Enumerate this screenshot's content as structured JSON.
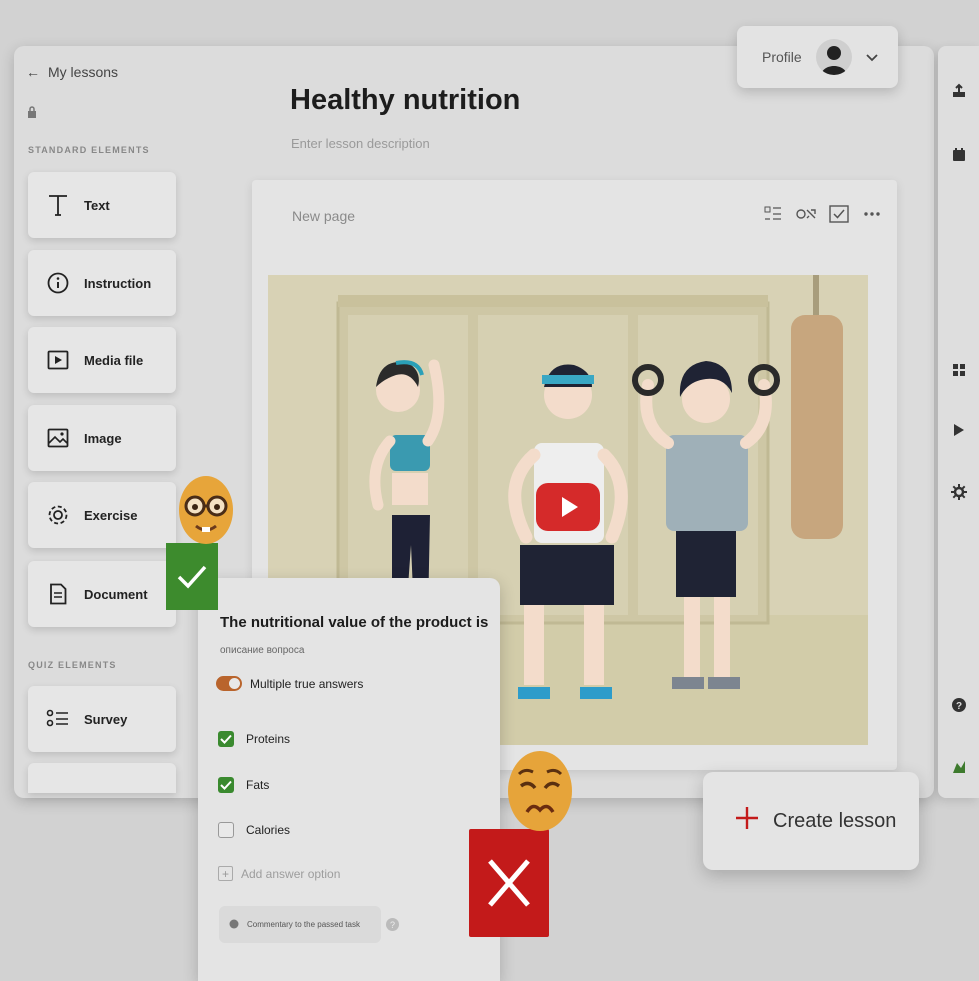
{
  "editor": {
    "back_label": "My lessons",
    "standard_section": "STANDARD ELEMENTS",
    "quiz_section": "QUIZ ELEMENTS",
    "elements": [
      {
        "label": "Text",
        "icon": "text-icon"
      },
      {
        "label": "Instruction",
        "icon": "info-icon"
      },
      {
        "label": "Media file",
        "icon": "media-icon"
      },
      {
        "label": "Image",
        "icon": "image-icon"
      },
      {
        "label": "Exercise",
        "icon": "gear-icon"
      },
      {
        "label": "Document",
        "icon": "document-icon"
      }
    ],
    "quiz_elements": [
      {
        "label": "Survey",
        "icon": "survey-icon"
      },
      {
        "label": "",
        "icon": ""
      }
    ]
  },
  "lesson": {
    "title": "Healthy nutrition",
    "description_placeholder": "Enter lesson description"
  },
  "profile": {
    "label": "Profile"
  },
  "page": {
    "name": "New page"
  },
  "quiz": {
    "question": "The nutritional value of the product is",
    "subtitle": "описание вопроса",
    "toggle_label": "Multiple true answers",
    "toggle_on": true,
    "answers": [
      {
        "label": "Proteins",
        "checked": true
      },
      {
        "label": "Fats",
        "checked": true
      },
      {
        "label": "Calories",
        "checked": false
      }
    ],
    "add_option": "Add answer option",
    "comment_button": "Commentary to the passed task"
  },
  "create_lesson": {
    "label": "Create lesson"
  },
  "colors": {
    "accent_red": "#c31a1a",
    "accent_green": "#3d8b2d",
    "toggle_orange": "#b9642c",
    "video_bg": "#d7d1b4"
  }
}
